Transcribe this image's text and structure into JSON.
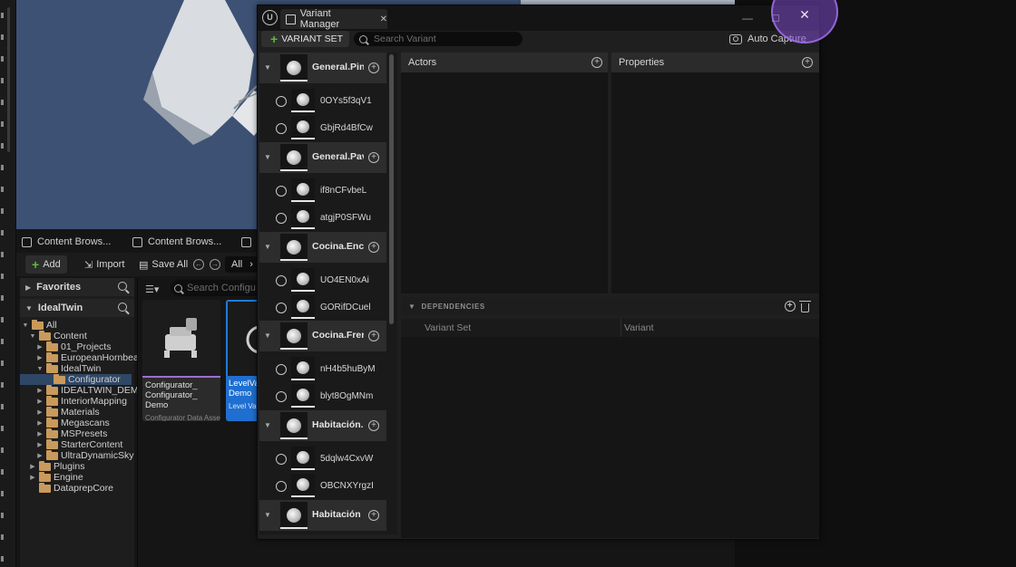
{
  "content_browser": {
    "tabs": [
      "Content Brows...",
      "Content Brows...",
      "C"
    ],
    "toolbar": {
      "add": "Add",
      "import": "Import",
      "save_all": "Save All",
      "filter_all": "All"
    },
    "favorites": "Favorites",
    "project": "IdealTwin",
    "search_placeholder": "Search Configu",
    "tree": [
      {
        "label": "All"
      },
      {
        "label": "Content"
      },
      {
        "label": "01_Projects"
      },
      {
        "label": "EuropeanHornbea"
      },
      {
        "label": "IdealTwin"
      },
      {
        "label": "Configurator"
      },
      {
        "label": "IDEALTWIN_DEMC"
      },
      {
        "label": "InteriorMapping"
      },
      {
        "label": "Materials"
      },
      {
        "label": "Megascans"
      },
      {
        "label": "MSPresets"
      },
      {
        "label": "StarterContent"
      },
      {
        "label": "UltraDynamicSky"
      },
      {
        "label": "Plugins"
      },
      {
        "label": "Engine"
      },
      {
        "label": "DataprepCore"
      }
    ],
    "assets": [
      {
        "name": "Configurator_ Configurator_ Demo",
        "type": "Configurator Data Asset"
      },
      {
        "name": "LevelVa Configu Demo",
        "type": "Level Var"
      }
    ]
  },
  "variant_manager": {
    "title": "Variant Manager",
    "toolbar": {
      "variant_set_button": "VARIANT SET",
      "search_placeholder": "Search Variant",
      "auto_capture": "Auto Capture"
    },
    "variant_sets": [
      {
        "name": "General.Pin",
        "variants": [
          "0OYs5f3qV1",
          "GbjRd4BfCw"
        ]
      },
      {
        "name": "General.Pav",
        "variants": [
          "if8nCFvbeL",
          "atgjP0SFWu"
        ]
      },
      {
        "name": "Cocina.Enci",
        "variants": [
          "UO4EN0xAi",
          "GORifDCuel"
        ]
      },
      {
        "name": "Cocina.Fren",
        "variants": [
          "nH4b5huByM",
          "blyt8OgMNm"
        ]
      },
      {
        "name": "Habitación.",
        "variants": [
          "5dqlw4CxvW",
          "OBCNXYrgzI"
        ]
      },
      {
        "name": "Habitación",
        "variants": []
      }
    ],
    "panels": {
      "actors": "Actors",
      "properties": "Properties"
    },
    "dependencies": {
      "title": "DEPENDENCIES",
      "col_variant_set": "Variant Set",
      "col_variant": "Variant"
    }
  },
  "colors": {
    "accent_green": "#5cba3c",
    "selection_blue": "#1f6fd0",
    "cursor_highlight": "#8b55d8"
  }
}
